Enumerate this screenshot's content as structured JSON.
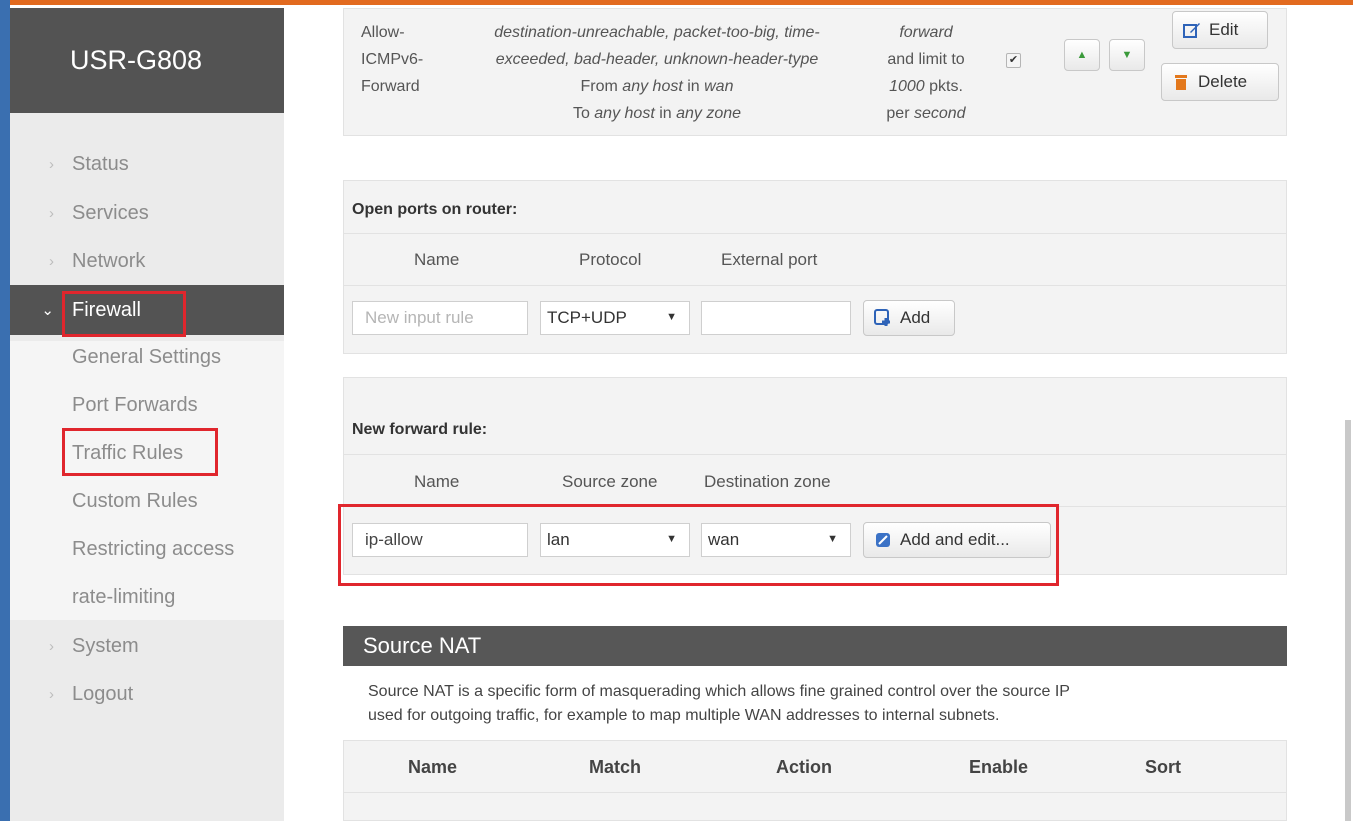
{
  "brand": "USR-G808",
  "nav": {
    "status": "Status",
    "services": "Services",
    "network": "Network",
    "firewall": "Firewall",
    "firewall_sub": [
      "General Settings",
      "Port Forwards",
      "Traffic Rules",
      "Custom Rules",
      "Restricting access",
      "rate-limiting"
    ],
    "system": "System",
    "logout": "Logout"
  },
  "icmp_rule": {
    "name": [
      "Allow-",
      "ICMPv6-",
      "Forward"
    ],
    "match_line1": "destination-unreachable, packet-too-big, time-",
    "match_line2": "exceeded, bad-header, unknown-header-type",
    "from_prefix": "From ",
    "from_host": "any host",
    "in": " in ",
    "from_zone": "wan",
    "to_prefix": "To ",
    "to_host": "any host",
    "to_zone": "any zone",
    "action": "forward",
    "limit_line": "and limit to",
    "limit_value": "1000",
    "limit_unit": " pkts.",
    "per": "per ",
    "period": "second",
    "enabled": true,
    "edit_label": "Edit",
    "delete_label": "Delete"
  },
  "open_ports": {
    "caption": "Open ports on router:",
    "col_name": "Name",
    "col_protocol": "Protocol",
    "col_port": "External port",
    "name_placeholder": "New input rule",
    "protocol_value": "TCP+UDP",
    "port_value": "",
    "add_label": "Add"
  },
  "forward_rule": {
    "caption": "New forward rule:",
    "col_name": "Name",
    "col_src": "Source zone",
    "col_dst": "Destination zone",
    "name_value": "ip-allow",
    "src_value": "lan",
    "dst_value": "wan",
    "add_edit_label": "Add and edit..."
  },
  "snat": {
    "title": "Source NAT",
    "desc_line1": "Source NAT is a specific form of masquerading which allows fine grained control over the source IP",
    "desc_line2": "used for outgoing traffic, for example to map multiple WAN addresses to internal subnets.",
    "headers": [
      "Name",
      "Match",
      "Action",
      "Enable",
      "Sort"
    ]
  },
  "colors": {
    "sidebar_bg": "#ebebeb",
    "brand_bg": "#535353",
    "highlight": "#e0262d",
    "accent_top": "#e26a1f"
  }
}
